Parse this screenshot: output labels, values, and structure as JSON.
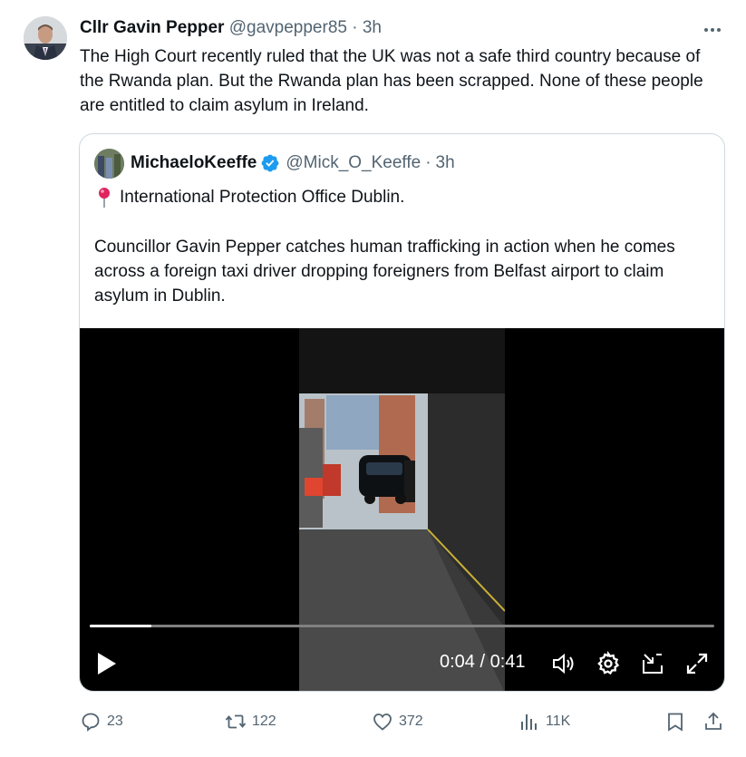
{
  "tweet": {
    "author_name": "Cllr Gavin Pepper",
    "author_handle": "@gavpepper85",
    "separator": "·",
    "time": "3h",
    "more_label": "•••",
    "text": "The High Court recently ruled that the UK was not a safe third country because of the Rwanda plan. But the Rwanda plan has been scrapped. None of these people are entitled to claim asylum in Ireland."
  },
  "quote": {
    "author_name": "MichaeloKeeffe",
    "author_handle": "@Mick_O_Keeffe",
    "separator": "·",
    "time": "3h",
    "location_line": "International Protection Office Dublin.",
    "body": "Councillor Gavin Pepper catches human trafficking in action when he comes across a foreign taxi driver dropping foreigners from Belfast airport to claim asylum in Dublin."
  },
  "video": {
    "current_time": "0:04",
    "duration": "0:41",
    "time_display": "0:04 / 0:41",
    "progress_fraction": 0.098
  },
  "actions": {
    "replies": "23",
    "reposts": "122",
    "likes": "372",
    "views": "11K"
  },
  "icons": {
    "verified": "verified-badge-icon",
    "pin": "round-pushpin-icon",
    "play": "play-icon",
    "volume": "volume-icon",
    "settings": "settings-gear-icon",
    "pip": "picture-in-picture-icon",
    "fullscreen": "fullscreen-icon",
    "reply": "reply-bubble-icon",
    "repost": "repost-icon",
    "like": "heart-icon",
    "views": "bar-chart-icon",
    "bookmark": "bookmark-icon",
    "share": "share-icon"
  },
  "colors": {
    "text_primary": "#0f1419",
    "text_muted": "#536471",
    "verified_blue": "#1d9bf0",
    "border": "#cfd9de",
    "pin_red": "#e0245e"
  }
}
